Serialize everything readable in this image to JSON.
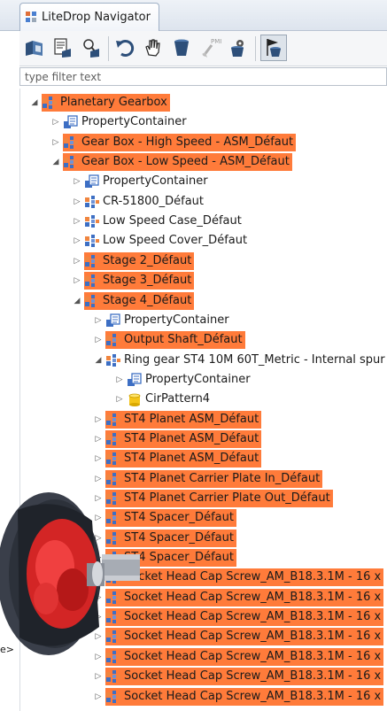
{
  "window": {
    "tab_title": "LiteDrop Navigator"
  },
  "filter": {
    "placeholder": "type filter text"
  },
  "colors": {
    "highlight": "#ff7b3a",
    "tab_bg": "#e8edf4",
    "tree_bg": "#ffffff"
  },
  "toolbar": {
    "buttons": [
      {
        "name": "assembly-view-icon"
      },
      {
        "name": "part-properties-icon"
      },
      {
        "name": "replace-parts-icon"
      },
      {
        "name": "undo-icon"
      },
      {
        "name": "hand-pan-icon"
      },
      {
        "name": "bucket-icon"
      },
      {
        "name": "pmi-icon",
        "label": "PMI"
      },
      {
        "name": "gear-settings-icon"
      },
      {
        "name": "flag-bucket-icon",
        "pressed": true
      }
    ]
  },
  "tree": {
    "nodes": [
      {
        "label": "Planetary Gearbox",
        "level": 0,
        "twisty": "open",
        "icon": "assembly",
        "highlight": true
      },
      {
        "label": "PropertyContainer",
        "level": 1,
        "twisty": "closed",
        "icon": "property",
        "highlight": false
      },
      {
        "label": "Gear Box - High Speed - ASM_Défaut",
        "level": 1,
        "twisty": "closed",
        "icon": "assembly",
        "highlight": true
      },
      {
        "label": "Gear Box - Low Speed - ASM_Défaut",
        "level": 1,
        "twisty": "open",
        "icon": "assembly",
        "highlight": true
      },
      {
        "label": "PropertyContainer",
        "level": 2,
        "twisty": "closed",
        "icon": "property",
        "highlight": false
      },
      {
        "label": "CR-51800_Défaut",
        "level": 2,
        "twisty": "closed",
        "icon": "assembly",
        "highlight": false
      },
      {
        "label": "Low Speed Case_Défaut",
        "level": 2,
        "twisty": "closed",
        "icon": "assembly",
        "highlight": false
      },
      {
        "label": "Low Speed Cover_Défaut",
        "level": 2,
        "twisty": "closed",
        "icon": "assembly",
        "highlight": false
      },
      {
        "label": "Stage 2_Défaut",
        "level": 2,
        "twisty": "closed",
        "icon": "assembly",
        "highlight": true
      },
      {
        "label": "Stage 3_Défaut",
        "level": 2,
        "twisty": "closed",
        "icon": "assembly",
        "highlight": true
      },
      {
        "label": "Stage 4_Défaut",
        "level": 2,
        "twisty": "open",
        "icon": "assembly",
        "highlight": true
      },
      {
        "label": "PropertyContainer",
        "level": 3,
        "twisty": "closed",
        "icon": "property",
        "highlight": false
      },
      {
        "label": "Output Shaft_Défaut",
        "level": 3,
        "twisty": "closed",
        "icon": "assembly",
        "highlight": true
      },
      {
        "label": "Ring gear ST4 10M 60T_Metric - Internal spur",
        "level": 3,
        "twisty": "open",
        "icon": "assembly",
        "highlight": false
      },
      {
        "label": "PropertyContainer",
        "level": 4,
        "twisty": "closed",
        "icon": "property",
        "highlight": false
      },
      {
        "label": "CirPattern4",
        "level": 4,
        "twisty": "closed",
        "icon": "cylinder",
        "highlight": false
      },
      {
        "label": "ST4 Planet ASM_Défaut",
        "level": 3,
        "twisty": "closed",
        "icon": "assembly",
        "highlight": true
      },
      {
        "label": "ST4 Planet ASM_Défaut",
        "level": 3,
        "twisty": "closed",
        "icon": "assembly",
        "highlight": true
      },
      {
        "label": "ST4 Planet ASM_Défaut",
        "level": 3,
        "twisty": "closed",
        "icon": "assembly",
        "highlight": true
      },
      {
        "label": "ST4 Planet Carrier Plate In_Défaut",
        "level": 3,
        "twisty": "closed",
        "icon": "assembly",
        "highlight": true
      },
      {
        "label": "ST4 Planet Carrier Plate Out_Défaut",
        "level": 3,
        "twisty": "closed",
        "icon": "assembly",
        "highlight": true
      },
      {
        "label": "ST4 Spacer_Défaut",
        "level": 3,
        "twisty": "closed",
        "icon": "assembly",
        "highlight": true
      },
      {
        "label": "ST4 Spacer_Défaut",
        "level": 3,
        "twisty": "closed",
        "icon": "assembly",
        "highlight": true
      },
      {
        "label": "ST4 Spacer_Défaut",
        "level": 3,
        "twisty": "closed",
        "icon": "assembly",
        "highlight": true
      },
      {
        "label": "Socket Head Cap Screw_AM_B18.3.1M - 16 x",
        "level": 3,
        "twisty": "closed",
        "icon": "assembly",
        "highlight": true
      },
      {
        "label": "Socket Head Cap Screw_AM_B18.3.1M - 16 x",
        "level": 3,
        "twisty": "closed",
        "icon": "assembly",
        "highlight": true
      },
      {
        "label": "Socket Head Cap Screw_AM_B18.3.1M - 16 x",
        "level": 3,
        "twisty": "closed",
        "icon": "assembly",
        "highlight": true
      },
      {
        "label": "Socket Head Cap Screw_AM_B18.3.1M - 16 x",
        "level": 3,
        "twisty": "closed",
        "icon": "assembly",
        "highlight": true
      },
      {
        "label": "Socket Head Cap Screw_AM_B18.3.1M - 16 x",
        "level": 3,
        "twisty": "closed",
        "icon": "assembly",
        "highlight": true
      },
      {
        "label": "Socket Head Cap Screw_AM_B18.3.1M - 16 x",
        "level": 3,
        "twisty": "closed",
        "icon": "assembly",
        "highlight": true
      },
      {
        "label": "Socket Head Cap Screw_AM_B18.3.1M - 16 x",
        "level": 3,
        "twisty": "closed",
        "icon": "assembly",
        "highlight": true
      }
    ]
  },
  "render": {
    "caption": "e>"
  }
}
